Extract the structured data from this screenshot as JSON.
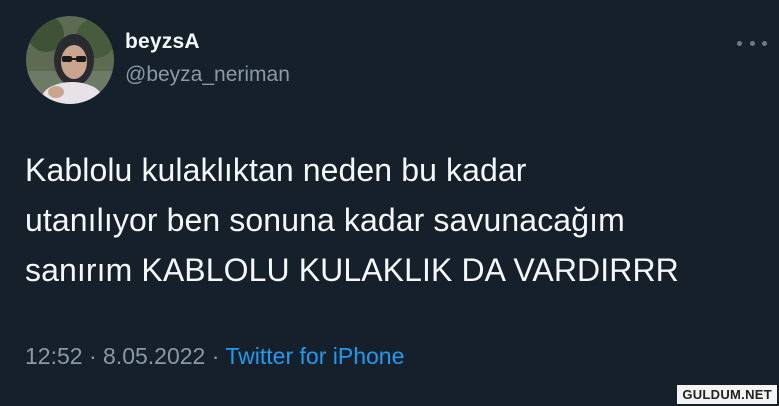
{
  "user": {
    "display_name": "beyzsA",
    "handle": "@beyza_neriman"
  },
  "tweet": {
    "lines": [
      "Kablolu kulaklıktan neden bu kadar",
      "utanılıyor ben sonuna kadar savunacağım",
      "sanırım KABLOLU KULAKLIK DA VARDIRRR"
    ]
  },
  "meta": {
    "time": "12:52",
    "separator": "·",
    "date": "8.05.2022",
    "source": "Twitter for iPhone"
  },
  "watermark": "GULDUM.NET",
  "icons": {
    "more": "more-options-icon"
  },
  "colors": {
    "background": "#15202b",
    "secondary_text": "#8b98a5",
    "link": "#1d9bf0"
  }
}
